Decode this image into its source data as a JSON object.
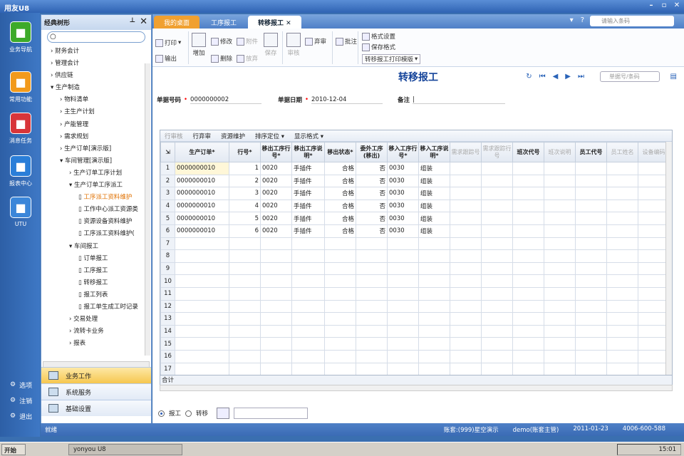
{
  "window": {
    "title": "用友U8"
  },
  "leftnav": {
    "items": [
      {
        "label": "业务导航",
        "icon": "business-nav-icon",
        "color": "#3daa2a"
      },
      {
        "label": "常用功能",
        "icon": "star-icon",
        "color": "#f29a1c"
      },
      {
        "label": "消息任务",
        "icon": "mail-icon",
        "color": "#d8353a"
      },
      {
        "label": "报表中心",
        "icon": "report-icon",
        "color": "#2a7ed8"
      },
      {
        "label": "UTU",
        "icon": "utu-icon",
        "color": "#3b86d9"
      }
    ],
    "bottom": [
      "选项",
      "注销",
      "退出"
    ]
  },
  "tree": {
    "title": "经典树形",
    "items": [
      {
        "label": "财务会计",
        "level": 1,
        "arrow": "right"
      },
      {
        "label": "管理会计",
        "level": 1,
        "arrow": "right"
      },
      {
        "label": "供应链",
        "level": 1,
        "arrow": "right"
      },
      {
        "label": "生产制造",
        "level": 1,
        "arrow": "down"
      },
      {
        "label": "物料清单",
        "level": 2,
        "arrow": "right"
      },
      {
        "label": "主生产计划",
        "level": 2,
        "arrow": "right"
      },
      {
        "label": "产能管理",
        "level": 2,
        "arrow": "right"
      },
      {
        "label": "需求规划",
        "level": 2,
        "arrow": "right"
      },
      {
        "label": "生产订单[演示版]",
        "level": 2,
        "arrow": "right"
      },
      {
        "label": "车间管理[演示版]",
        "level": 2,
        "arrow": "down"
      },
      {
        "label": "生产订单工序计划",
        "level": 3,
        "arrow": "right"
      },
      {
        "label": "生产订单工序派工",
        "level": 3,
        "arrow": "down"
      },
      {
        "label": "工序派工资料维护",
        "level": 4,
        "doc": true,
        "selected": true
      },
      {
        "label": "工作中心派工资源类",
        "level": 4,
        "doc": true
      },
      {
        "label": "资源设备资料维护",
        "level": 4,
        "doc": true
      },
      {
        "label": "工序派工资料维护(",
        "level": 4,
        "doc": true
      },
      {
        "label": "车间报工",
        "level": 3,
        "arrow": "down"
      },
      {
        "label": "订单报工",
        "level": 4,
        "doc": true
      },
      {
        "label": "工序报工",
        "level": 4,
        "doc": true
      },
      {
        "label": "转移报工",
        "level": 4,
        "doc": true
      },
      {
        "label": "报工列表",
        "level": 4,
        "doc": true
      },
      {
        "label": "报工单生成工时记录",
        "level": 4,
        "doc": true
      },
      {
        "label": "交易处理",
        "level": 3,
        "arrow": "right"
      },
      {
        "label": "流转卡业务",
        "level": 3,
        "arrow": "right"
      },
      {
        "label": "报表",
        "level": 3,
        "arrow": "right"
      }
    ],
    "bottom_menu": [
      {
        "label": "业务工作",
        "active": true
      },
      {
        "label": "系统服务"
      },
      {
        "label": "基础设置"
      }
    ]
  },
  "tabs": [
    {
      "label": "我的桌面",
      "kind": "home"
    },
    {
      "label": "工序报工"
    },
    {
      "label": "转移报工",
      "kind": "active"
    }
  ],
  "top": {
    "search_placeholder": "请输入条码"
  },
  "toolbar": {
    "print": "打印",
    "export": "输出",
    "add": "增加",
    "modify": "修改",
    "delete": "删除",
    "attach": "附件",
    "abandon": "放弃",
    "save": "保存",
    "audit": "审核",
    "unaudit": "弃审",
    "approve": "批注",
    "format_setting": "格式设置",
    "save_format": "保存格式",
    "template": "转移报工打印模版"
  },
  "form": {
    "title": "转移报工",
    "doc_search_placeholder": "单据号/条码",
    "doc_no_label": "单据号码",
    "doc_no": "0000000002",
    "doc_date_label": "单据日期",
    "doc_date": "2010-12-04",
    "remark_label": "备注"
  },
  "grid_toolbar": [
    "行审核",
    "行弃审",
    "资源维护",
    "排序定位",
    "显示格式"
  ],
  "columns": [
    "生产订单*",
    "行号*",
    "移出工序行号*",
    "移出工序说明*",
    "移出状态*",
    "委外工序(移出)",
    "移入工序行号*",
    "移入工序说明*",
    "需求跟踪号",
    "需求跟踪行号",
    "班次代号",
    "班次说明",
    "员工代号",
    "员工姓名",
    "设备编码"
  ],
  "rows": [
    [
      "0000000010",
      "1",
      "0020",
      "手插件",
      "合格",
      "否",
      "0030",
      "组装"
    ],
    [
      "0000000010",
      "2",
      "0020",
      "手插件",
      "合格",
      "否",
      "0030",
      "组装"
    ],
    [
      "0000000010",
      "3",
      "0020",
      "手插件",
      "合格",
      "否",
      "0030",
      "组装"
    ],
    [
      "0000000010",
      "4",
      "0020",
      "手插件",
      "合格",
      "否",
      "0030",
      "组装"
    ],
    [
      "0000000010",
      "5",
      "0020",
      "手插件",
      "合格",
      "否",
      "0030",
      "组装"
    ],
    [
      "0000000010",
      "6",
      "0020",
      "手插件",
      "合格",
      "否",
      "0030",
      "组装"
    ]
  ],
  "row_numbers": [
    "1",
    "2",
    "3",
    "4",
    "5",
    "6",
    "7",
    "8",
    "9",
    "10",
    "11",
    "12",
    "13",
    "14",
    "15",
    "16",
    "17"
  ],
  "summary_label": "合计",
  "radios": {
    "report": "报工",
    "transfer": "转移"
  },
  "status": {
    "left": "就绪",
    "account": "账套:(999)星空演示",
    "user": "demo(账套主管)",
    "date": "2011-01-23",
    "phone": "4006-600-588"
  },
  "taskbar": {
    "start": "开始",
    "app": "yonyou U8",
    "time": "15:01"
  }
}
